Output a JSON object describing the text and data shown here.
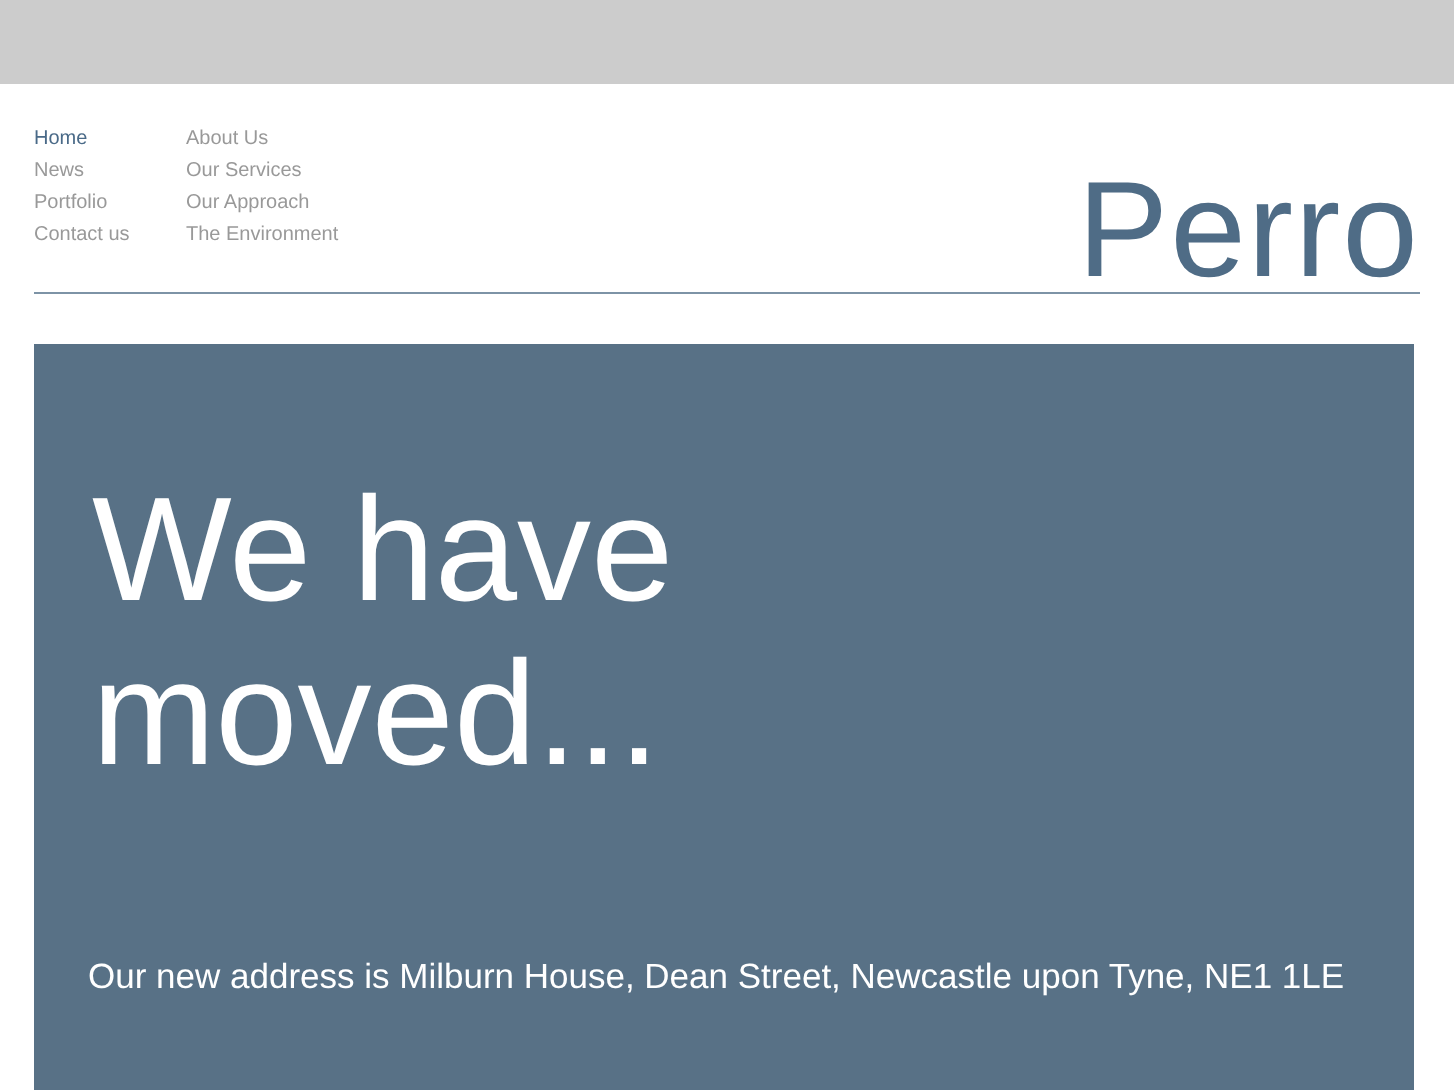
{
  "nav": {
    "items": [
      {
        "label": "Home",
        "selected": true
      },
      {
        "label": "News",
        "selected": false
      },
      {
        "label": "Portfolio",
        "selected": false
      },
      {
        "label": "Contact us",
        "selected": false
      },
      {
        "label": "About Us",
        "selected": false
      },
      {
        "label": "Our Services",
        "selected": false
      },
      {
        "label": "Our Approach",
        "selected": false
      },
      {
        "label": "The Environment",
        "selected": false
      }
    ]
  },
  "logo": "Perro",
  "hero": {
    "heading_lines": [
      "We have",
      "moved..."
    ],
    "address": "Our new address is Milburn House, Dean Street, Newcastle upon Tyne, NE1 1LE"
  }
}
